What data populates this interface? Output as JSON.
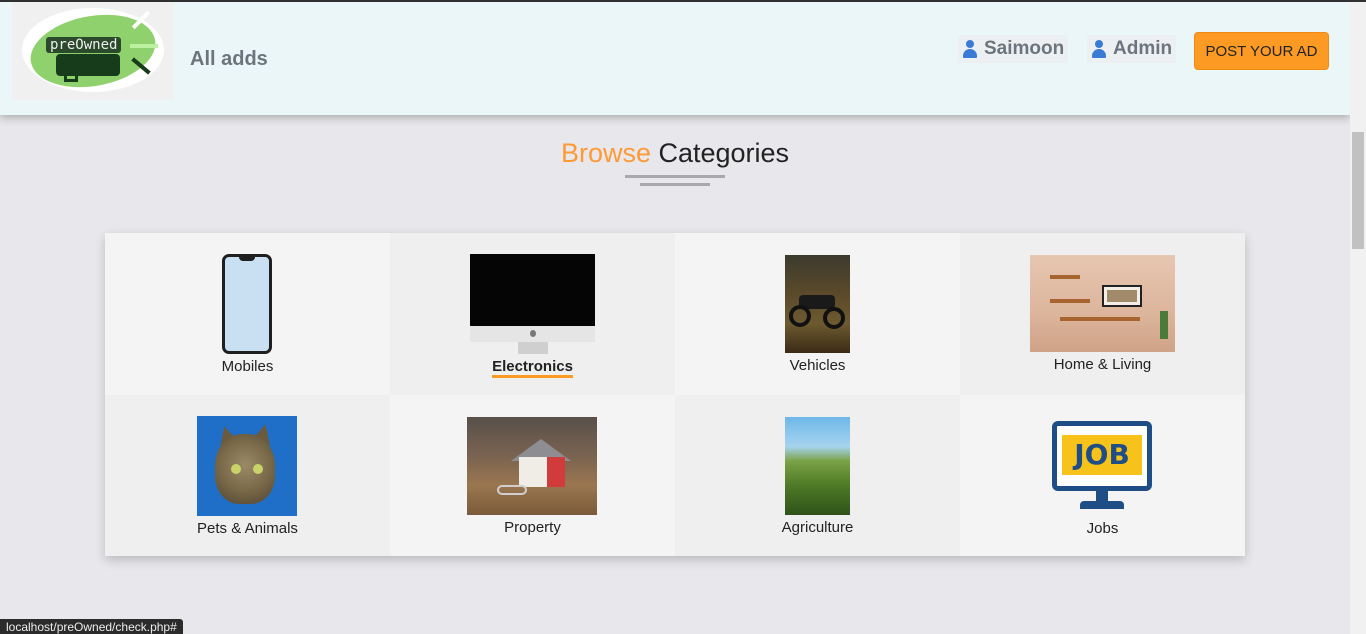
{
  "header": {
    "logo_text": "preOwned",
    "all_adds": "All adds",
    "user_name": "Saimoon",
    "admin_label": "Admin",
    "post_button": "POST YOUR AD"
  },
  "section": {
    "title_accent": "Browse",
    "title_rest": "Categories"
  },
  "categories": [
    {
      "label": "Mobiles",
      "icon": "smartphone-image"
    },
    {
      "label": "Electronics",
      "icon": "imac-image",
      "active": true
    },
    {
      "label": "Vehicles",
      "icon": "motorcycle-image"
    },
    {
      "label": "Home & Living",
      "icon": "living-room-image"
    },
    {
      "label": "Pets & Animals",
      "icon": "cat-image"
    },
    {
      "label": "Property",
      "icon": "house-keys-image"
    },
    {
      "label": "Agriculture",
      "icon": "wheat-field-image"
    },
    {
      "label": "Jobs",
      "icon": "job-monitor-image",
      "job_text": "JOB"
    }
  ],
  "status_url": "localhost/preOwned/check.php#",
  "colors": {
    "accent": "#fd9a23",
    "header_bg": "#eaf6f8",
    "page_bg": "#e8e8ec"
  }
}
